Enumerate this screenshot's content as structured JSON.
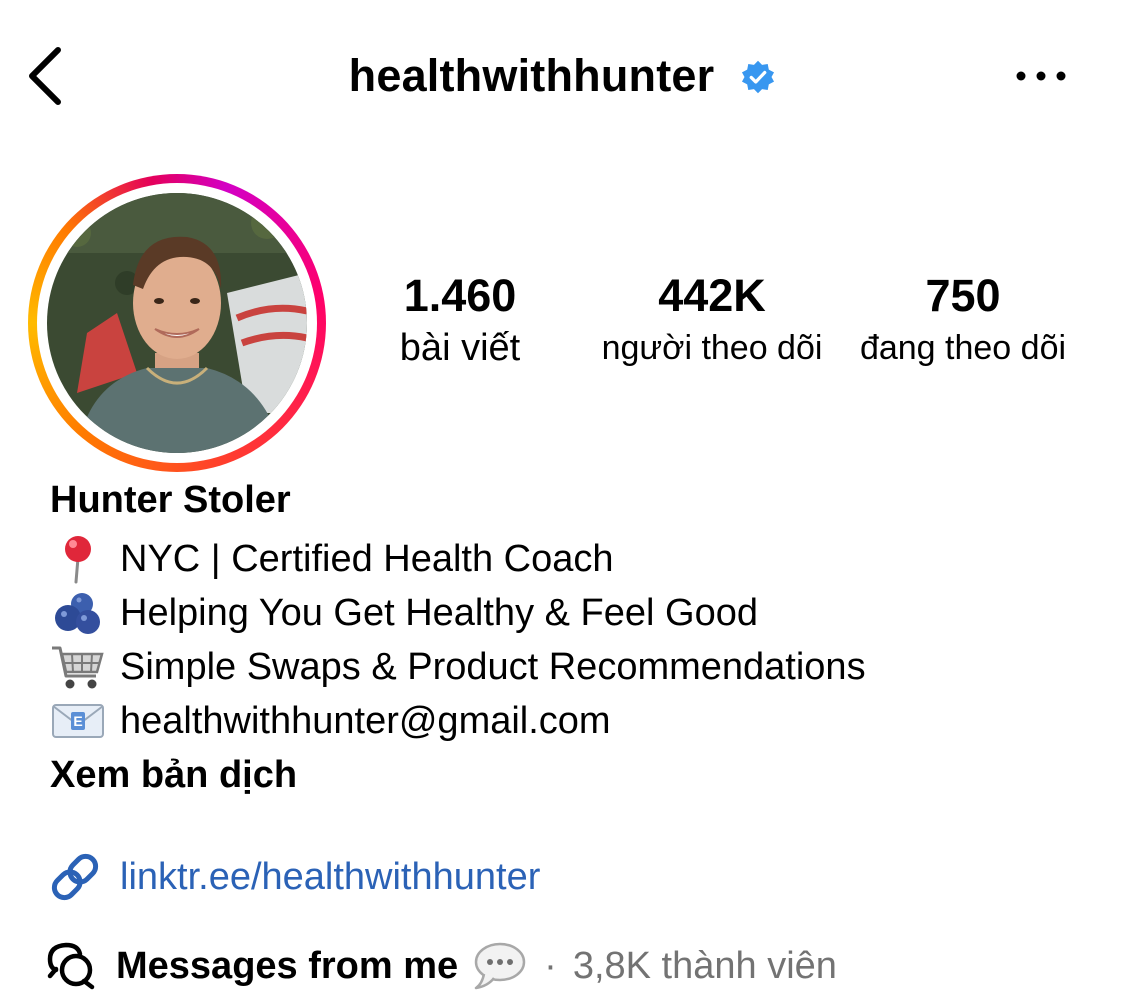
{
  "header": {
    "username": "healthwithhunter",
    "verified_icon": "verified-badge-icon",
    "back_icon": "chevron-left-icon",
    "more_icon": "more-horizontal-icon"
  },
  "stats": {
    "posts": {
      "value": "1.460",
      "label": "bài viết"
    },
    "followers": {
      "value": "442K",
      "label": "người theo dõi"
    },
    "following": {
      "value": "750",
      "label": "đang theo dõi"
    }
  },
  "profile": {
    "full_name": "Hunter Stoler",
    "bio": [
      {
        "emoji": "pushpin-icon",
        "text": "NYC | Certified Health Coach"
      },
      {
        "emoji": "blueberries-icon",
        "text": "Helping You Get Healthy & Feel Good"
      },
      {
        "emoji": "shopping-cart-icon",
        "text": "Simple Swaps & Product Recommendations"
      },
      {
        "emoji": "envelope-icon",
        "text": "healthwithhunter@gmail.com"
      }
    ],
    "translate_label": "Xem bản dịch",
    "link": "linktr.ee/healthwithhunter"
  },
  "channel": {
    "name": "Messages from me",
    "separator": "·",
    "members": "3,8K thành viên"
  },
  "colors": {
    "link": "#2b62b6",
    "verified": "#3897f0",
    "muted": "#737373"
  }
}
